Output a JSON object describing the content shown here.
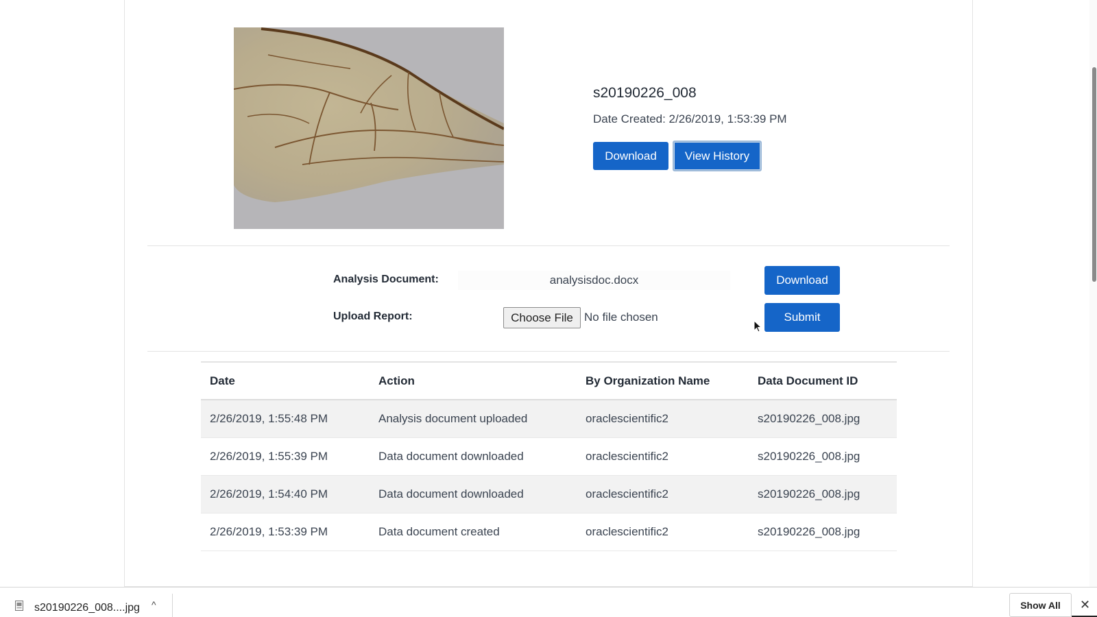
{
  "document": {
    "title": "s20190226_008",
    "date_created": "Date Created: 2/26/2019, 1:53:39 PM",
    "download_label": "Download",
    "view_history_label": "View History"
  },
  "analysis": {
    "label": "Analysis Document:",
    "file_name": "analysisdoc.docx",
    "download_label": "Download"
  },
  "upload": {
    "label": "Upload Report:",
    "choose_file_label": "Choose File",
    "no_file_text": "No file chosen",
    "submit_label": "Submit"
  },
  "history": {
    "columns": [
      "Date",
      "Action",
      "By Organization Name",
      "Data Document ID"
    ],
    "rows": [
      [
        "2/26/2019, 1:55:48 PM",
        "Analysis document uploaded",
        "oraclescientific2",
        "s20190226_008.jpg"
      ],
      [
        "2/26/2019, 1:55:39 PM",
        "Data document downloaded",
        "oraclescientific2",
        "s20190226_008.jpg"
      ],
      [
        "2/26/2019, 1:54:40 PM",
        "Data document downloaded",
        "oraclescientific2",
        "s20190226_008.jpg"
      ],
      [
        "2/26/2019, 1:53:39 PM",
        "Data document created",
        "oraclescientific2",
        "s20190226_008.jpg"
      ]
    ]
  },
  "download_bar": {
    "file_name": "s20190226_008....jpg",
    "chevron": "^",
    "show_all_label": "Show All",
    "close": "✕"
  },
  "colors": {
    "primary_button": "#1565c8",
    "row_stripe": "#f2f2f2"
  }
}
